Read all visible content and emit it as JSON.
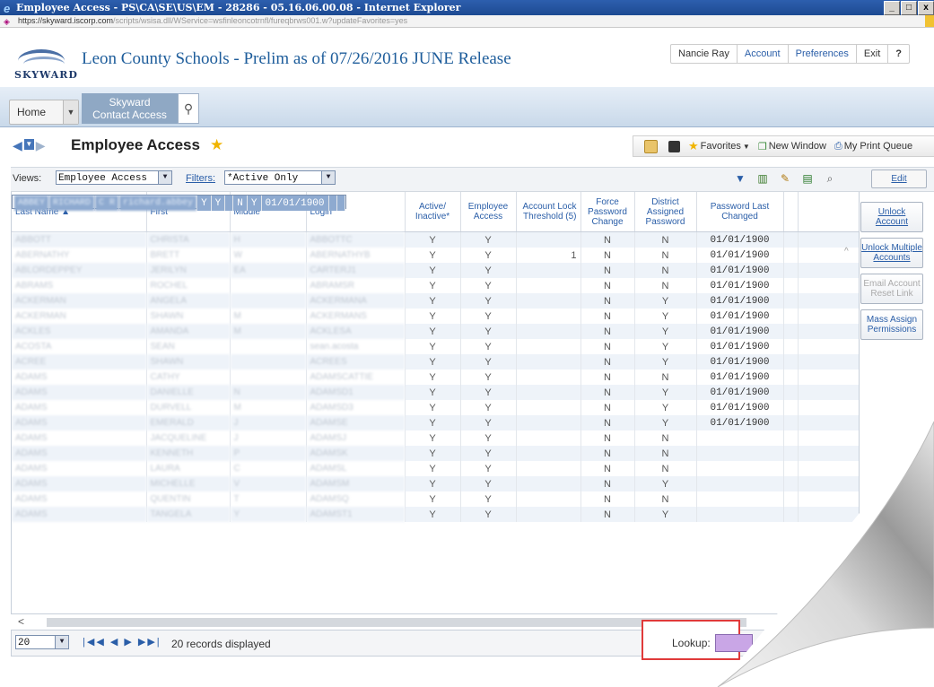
{
  "window": {
    "title": "Employee Access - PS\\CA\\SE\\US\\EM - 28286 - 05.16.06.00.08 - Internet Explorer",
    "url_host": "https://skyward.iscorp.com",
    "url_path": "/scripts/wsisa.dll/WService=wsfinleoncotrnfl/fureqbrws001.w?updateFavorites=yes",
    "buttons": [
      "_",
      "□",
      "x"
    ]
  },
  "header": {
    "logo_text": "SKYWARD",
    "app_title": "Leon County Schools - Prelim as of 07/26/2016 JUNE Release",
    "user_menu": [
      "Nancie Ray",
      "Account",
      "Preferences",
      "Exit",
      "?"
    ]
  },
  "nav": {
    "home": "Home",
    "tab_line1": "Skyward",
    "tab_line2": "Contact Access"
  },
  "page": {
    "title": "Employee Access",
    "toolbar": {
      "favorites": "Favorites",
      "new_window": "New Window",
      "print_queue": "My Print Queue"
    }
  },
  "views": {
    "views_label": "Views:",
    "views_value": "Employee Access",
    "filters_label": "Filters:",
    "filters_value": "*Active Only",
    "edit": "Edit"
  },
  "grid": {
    "columns": [
      "Last Name",
      "First",
      "Middle",
      "Login",
      "Active/ Inactive*",
      "Employee Access",
      "Account Lock Threshold (5)",
      "Force Password Change",
      "District Assigned Password",
      "Password Last Changed"
    ],
    "rows": [
      {
        "last": "ABBEY",
        "first": "RICHARD",
        "middle": "C R",
        "login": "richard.abbey",
        "active": "Y",
        "emp": "Y",
        "lock": "",
        "force": "N",
        "district": "Y",
        "changed": "01/01/1900"
      },
      {
        "last": "ABBOTT",
        "first": "CHRISTA",
        "middle": "H",
        "login": "ABBOTTC",
        "active": "Y",
        "emp": "Y",
        "lock": "",
        "force": "N",
        "district": "N",
        "changed": "01/01/1900"
      },
      {
        "last": "ABERNATHY",
        "first": "BRETT",
        "middle": "W",
        "login": "ABERNATHYB",
        "active": "Y",
        "emp": "Y",
        "lock": "1",
        "force": "N",
        "district": "N",
        "changed": "01/01/1900"
      },
      {
        "last": "ABLORDEPPEY",
        "first": "JERILYN",
        "middle": "EA",
        "login": "CARTERJ1",
        "active": "Y",
        "emp": "Y",
        "lock": "",
        "force": "N",
        "district": "N",
        "changed": "01/01/1900"
      },
      {
        "last": "ABRAMS",
        "first": "ROCHEL",
        "middle": "",
        "login": "ABRAMSR",
        "active": "Y",
        "emp": "Y",
        "lock": "",
        "force": "N",
        "district": "N",
        "changed": "01/01/1900"
      },
      {
        "last": "ACKERMAN",
        "first": "ANGELA",
        "middle": "",
        "login": "ACKERMANA",
        "active": "Y",
        "emp": "Y",
        "lock": "",
        "force": "N",
        "district": "Y",
        "changed": "01/01/1900"
      },
      {
        "last": "ACKERMAN",
        "first": "SHAWN",
        "middle": "M",
        "login": "ACKERMANS",
        "active": "Y",
        "emp": "Y",
        "lock": "",
        "force": "N",
        "district": "Y",
        "changed": "01/01/1900"
      },
      {
        "last": "ACKLES",
        "first": "AMANDA",
        "middle": "M",
        "login": "ACKLESA",
        "active": "Y",
        "emp": "Y",
        "lock": "",
        "force": "N",
        "district": "Y",
        "changed": "01/01/1900"
      },
      {
        "last": "ACOSTA",
        "first": "SEAN",
        "middle": "",
        "login": "sean.acosta",
        "active": "Y",
        "emp": "Y",
        "lock": "",
        "force": "N",
        "district": "Y",
        "changed": "01/01/1900"
      },
      {
        "last": "ACREE",
        "first": "SHAWN",
        "middle": "",
        "login": "ACREES",
        "active": "Y",
        "emp": "Y",
        "lock": "",
        "force": "N",
        "district": "Y",
        "changed": "01/01/1900"
      },
      {
        "last": "ADAMS",
        "first": "CATHY",
        "middle": "",
        "login": "ADAMSCATTIE",
        "active": "Y",
        "emp": "Y",
        "lock": "",
        "force": "N",
        "district": "N",
        "changed": "01/01/1900"
      },
      {
        "last": "ADAMS",
        "first": "DANIELLE",
        "middle": "N",
        "login": "ADAMSD1",
        "active": "Y",
        "emp": "Y",
        "lock": "",
        "force": "N",
        "district": "Y",
        "changed": "01/01/1900"
      },
      {
        "last": "ADAMS",
        "first": "DURVELL",
        "middle": "M",
        "login": "ADAMSD3",
        "active": "Y",
        "emp": "Y",
        "lock": "",
        "force": "N",
        "district": "Y",
        "changed": "01/01/1900"
      },
      {
        "last": "ADAMS",
        "first": "EMERALD",
        "middle": "J",
        "login": "ADAMSE",
        "active": "Y",
        "emp": "Y",
        "lock": "",
        "force": "N",
        "district": "Y",
        "changed": "01/01/1900"
      },
      {
        "last": "ADAMS",
        "first": "JACQUELINE",
        "middle": "J",
        "login": "ADAMSJ",
        "active": "Y",
        "emp": "Y",
        "lock": "",
        "force": "N",
        "district": "N",
        "changed": ""
      },
      {
        "last": "ADAMS",
        "first": "KENNETH",
        "middle": "P",
        "login": "ADAMSK",
        "active": "Y",
        "emp": "Y",
        "lock": "",
        "force": "N",
        "district": "N",
        "changed": ""
      },
      {
        "last": "ADAMS",
        "first": "LAURA",
        "middle": "C",
        "login": "ADAMSL",
        "active": "Y",
        "emp": "Y",
        "lock": "",
        "force": "N",
        "district": "N",
        "changed": ""
      },
      {
        "last": "ADAMS",
        "first": "MICHELLE",
        "middle": "V",
        "login": "ADAMSM",
        "active": "Y",
        "emp": "Y",
        "lock": "",
        "force": "N",
        "district": "Y",
        "changed": ""
      },
      {
        "last": "ADAMS",
        "first": "QUENTIN",
        "middle": "T",
        "login": "ADAMSQ",
        "active": "Y",
        "emp": "Y",
        "lock": "",
        "force": "N",
        "district": "N",
        "changed": ""
      },
      {
        "last": "ADAMS",
        "first": "TANGELA",
        "middle": "Y",
        "login": "ADAMST1",
        "active": "Y",
        "emp": "Y",
        "lock": "",
        "force": "N",
        "district": "Y",
        "changed": ""
      }
    ]
  },
  "side_buttons": [
    "Unlock Account",
    "Unlock Multiple Accounts",
    "Email Account Reset Link",
    "Mass Assign Permissions"
  ],
  "footer": {
    "page_size": "20",
    "pager": "|◀◀ ◀ ▶ ▶▶|",
    "records": "20 records displayed",
    "lookup_label": "Lookup:"
  },
  "colors": {
    "accent": "#2a5ea8",
    "selected_row": "#8eaad0",
    "highlight_box": "#e03a3a"
  }
}
